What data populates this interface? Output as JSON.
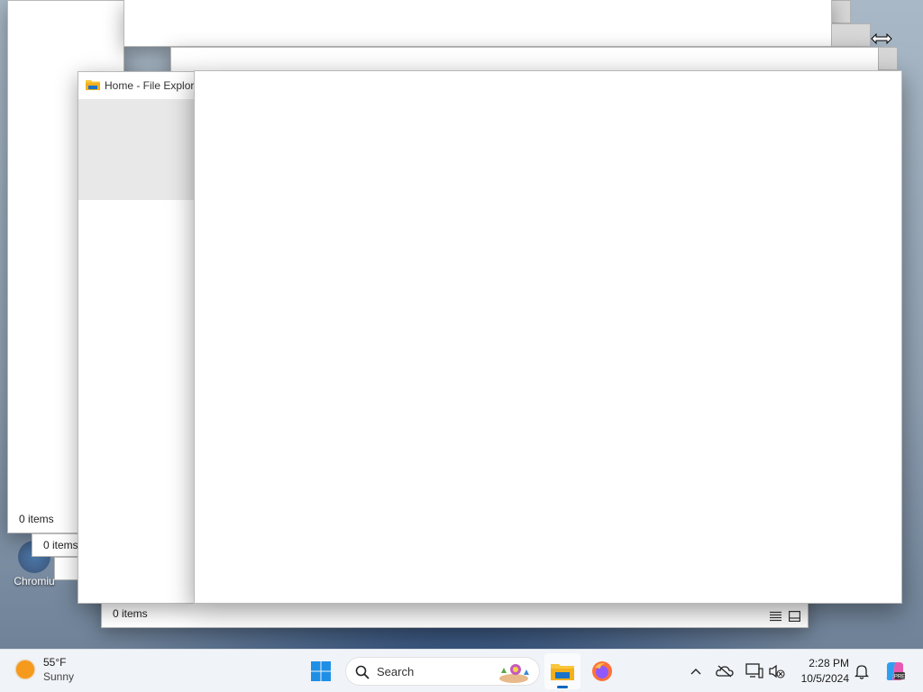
{
  "windows": {
    "back": {
      "status": "0 items"
    },
    "middle": {
      "status": "0 items"
    },
    "front": {
      "title": "Home - File Explore",
      "status": "0 items"
    }
  },
  "desktop": {
    "shortcut_label": "Chromiu"
  },
  "taskbar": {
    "weather": {
      "temp": "55°F",
      "condition": "Sunny"
    },
    "search_label": "Search",
    "clock": {
      "time": "2:28 PM",
      "date": "10/5/2024"
    }
  }
}
